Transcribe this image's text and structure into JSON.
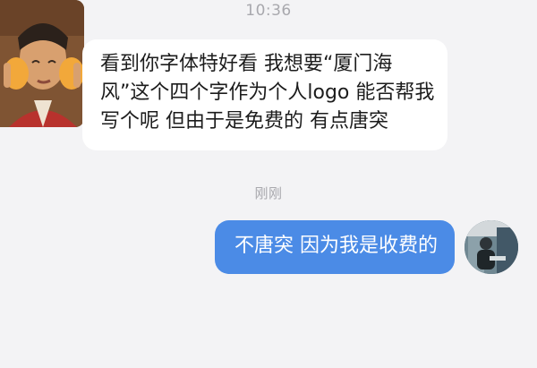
{
  "chat": {
    "timestamp": "10:36",
    "recent_label": "刚刚",
    "messages": [
      {
        "side": "left",
        "text": "看到你字体特好看 我想要“厦门海风”这个四个字作为个人logo 能否帮我写个呢  但由于是免费的 有点唐突"
      },
      {
        "side": "right",
        "text": "不唐突 因为我是收费的"
      }
    ]
  },
  "colors": {
    "background": "#f3f3f5",
    "incoming_bubble": "#ffffff",
    "outgoing_bubble": "#4b8be6",
    "timestamp_text": "#a8a8ad"
  }
}
